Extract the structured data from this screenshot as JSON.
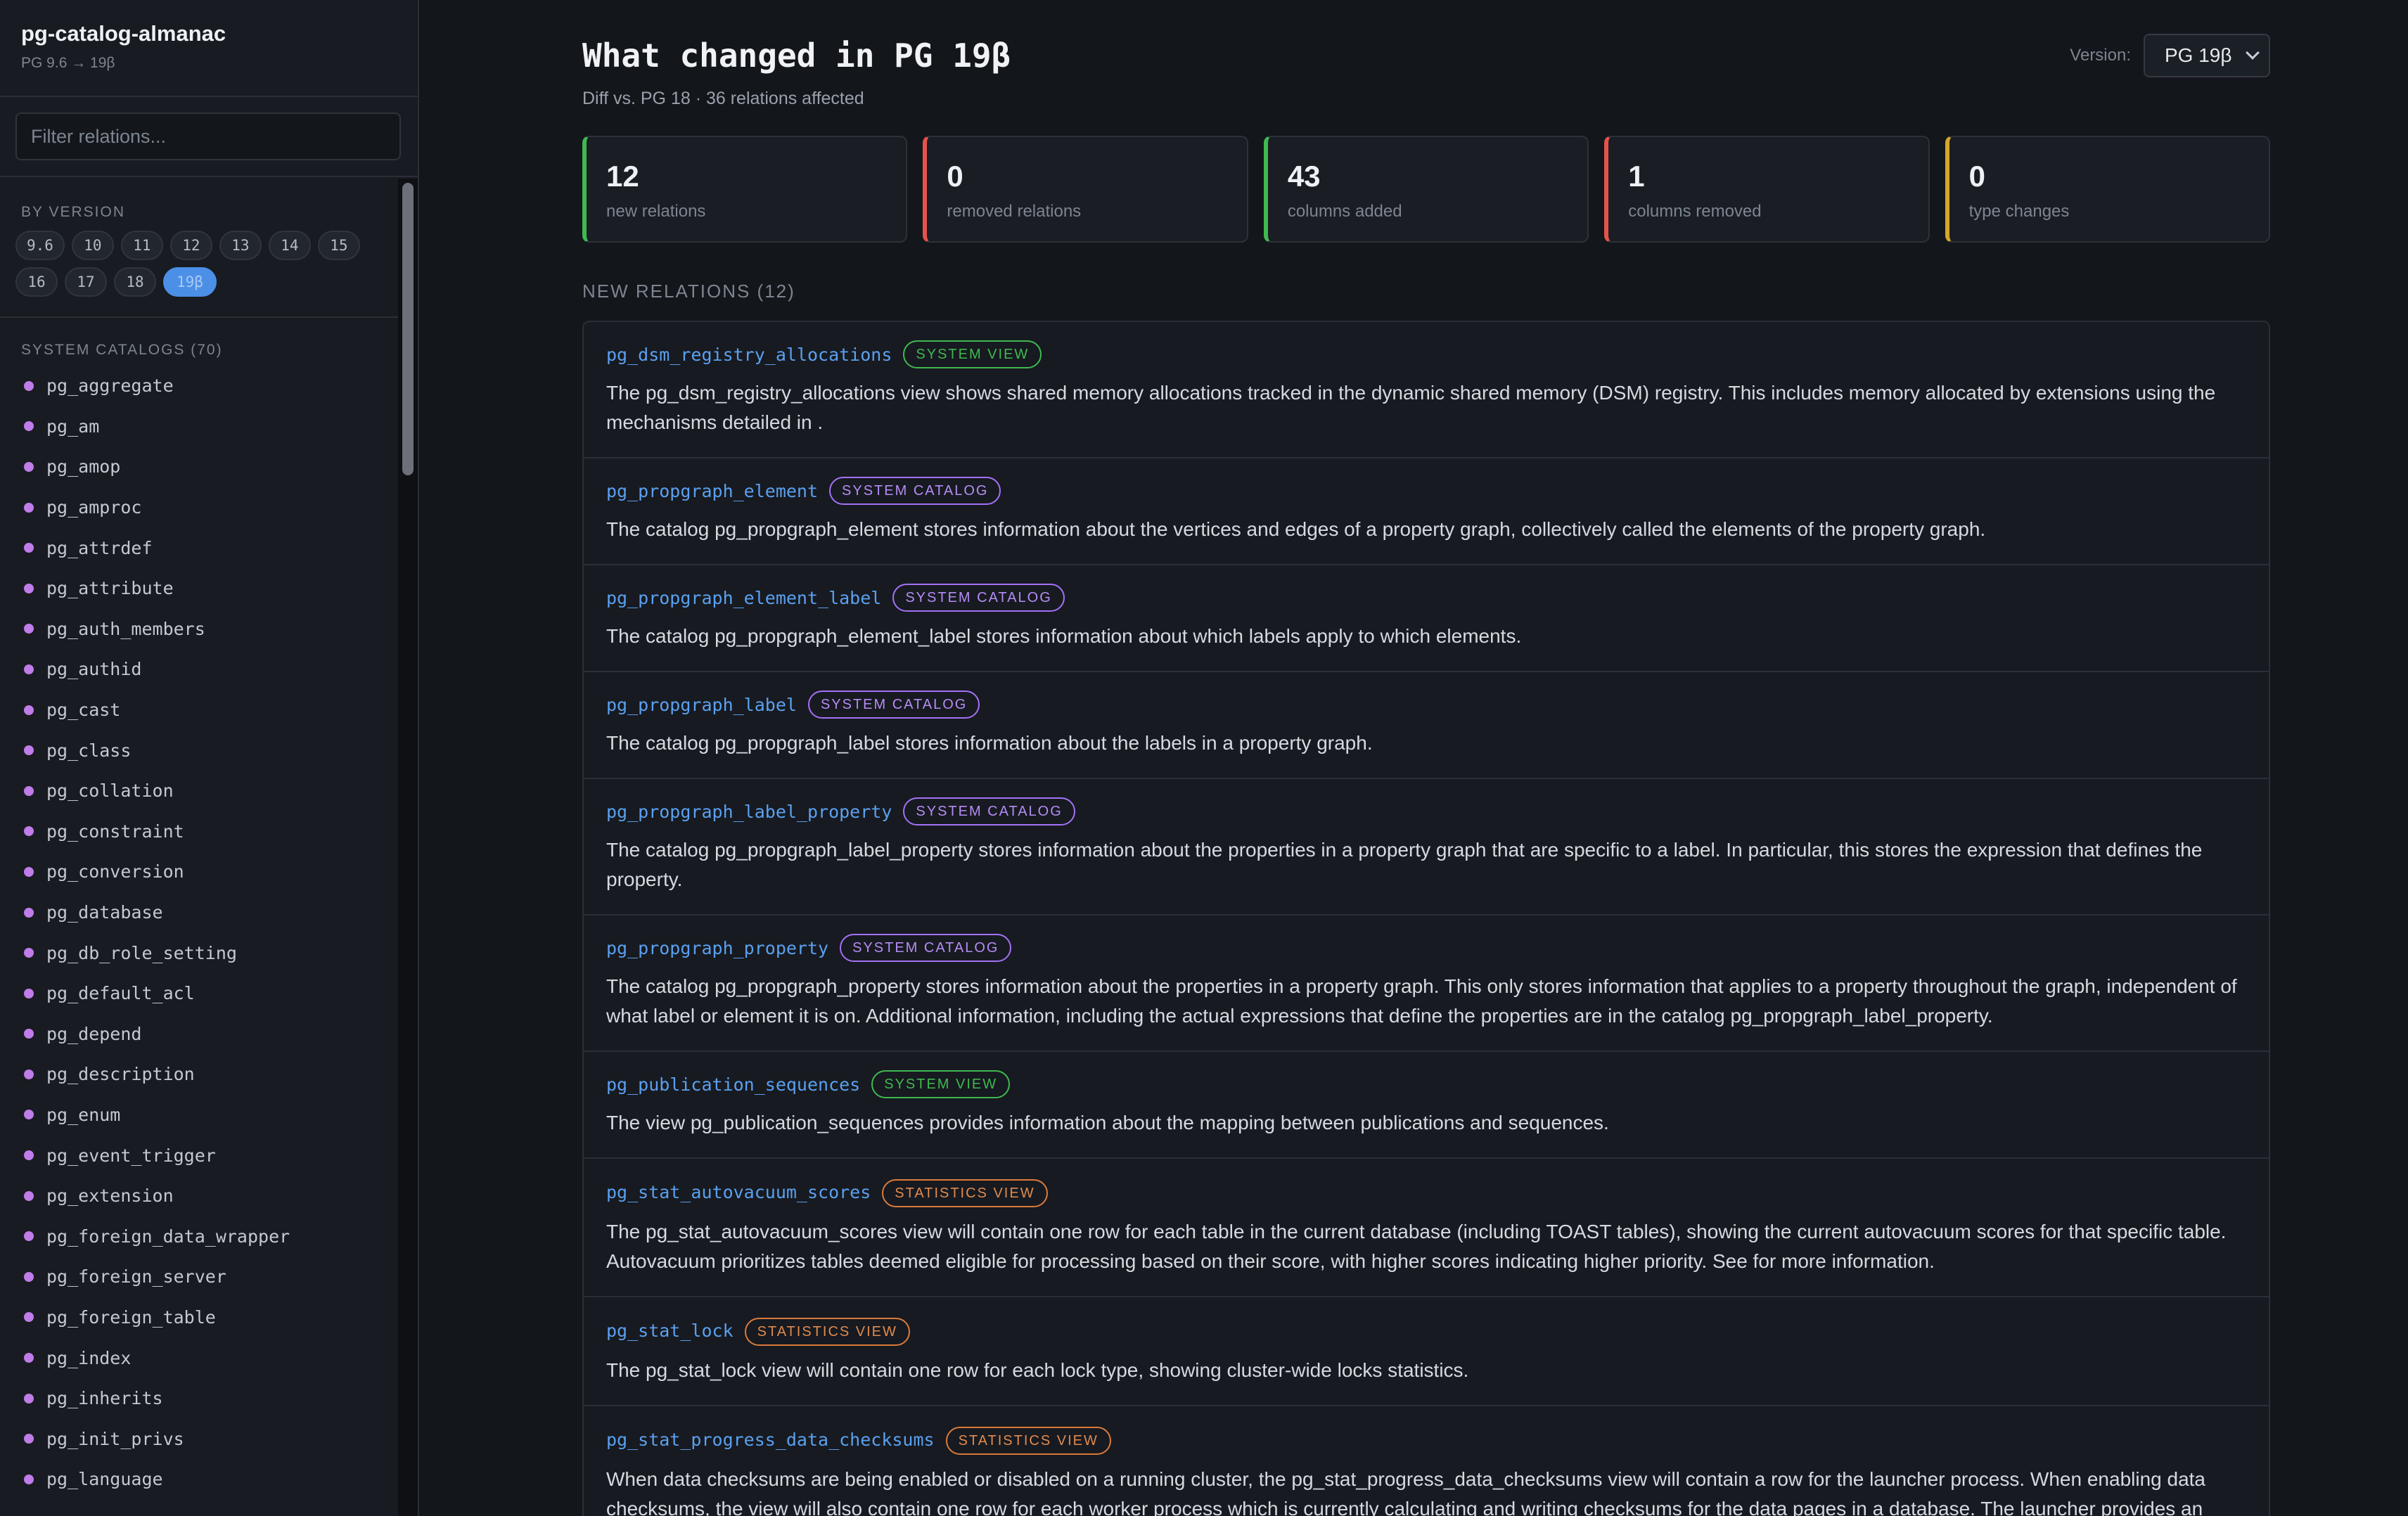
{
  "sidebar": {
    "title": "pg-catalog-almanac",
    "subtitle": "PG 9.6 → 19β",
    "filter_placeholder": "Filter relations...",
    "by_version_label": "BY VERSION",
    "versions": [
      "9.6",
      "10",
      "11",
      "12",
      "13",
      "14",
      "15",
      "16",
      "17",
      "18",
      "19β"
    ],
    "active_version": "19β",
    "catalogs_label": "SYSTEM CATALOGS (70)",
    "catalogs": [
      "pg_aggregate",
      "pg_am",
      "pg_amop",
      "pg_amproc",
      "pg_attrdef",
      "pg_attribute",
      "pg_auth_members",
      "pg_authid",
      "pg_cast",
      "pg_class",
      "pg_collation",
      "pg_constraint",
      "pg_conversion",
      "pg_database",
      "pg_db_role_setting",
      "pg_default_acl",
      "pg_depend",
      "pg_description",
      "pg_enum",
      "pg_event_trigger",
      "pg_extension",
      "pg_foreign_data_wrapper",
      "pg_foreign_server",
      "pg_foreign_table",
      "pg_index",
      "pg_inherits",
      "pg_init_privs",
      "pg_language"
    ]
  },
  "header": {
    "title": "What changed in PG 19β",
    "subtitle": "Diff vs. PG 18  ·  36 relations affected",
    "version_label": "Version:",
    "version_value": "PG 19β"
  },
  "stats": [
    {
      "value": "12",
      "label": "new relations",
      "color": "#3fb950"
    },
    {
      "value": "0",
      "label": "removed relations",
      "color": "#e5534b"
    },
    {
      "value": "43",
      "label": "columns added",
      "color": "#3fb950"
    },
    {
      "value": "1",
      "label": "columns removed",
      "color": "#e5534b"
    },
    {
      "value": "0",
      "label": "type changes",
      "color": "#d4a72c"
    }
  ],
  "new_relations": {
    "heading": "NEW RELATIONS (12)",
    "items": [
      {
        "name": "pg_dsm_registry_allocations",
        "badge": "SYSTEM VIEW",
        "kind": "view",
        "desc": "The pg_dsm_registry_allocations view shows shared memory allocations tracked in the dynamic shared memory (DSM) registry. This includes memory allocated by extensions using the mechanisms detailed in ."
      },
      {
        "name": "pg_propgraph_element",
        "badge": "SYSTEM CATALOG",
        "kind": "catalog",
        "desc": "The catalog pg_propgraph_element stores information about the vertices and edges of a property graph, collectively called the elements of the property graph."
      },
      {
        "name": "pg_propgraph_element_label",
        "badge": "SYSTEM CATALOG",
        "kind": "catalog",
        "desc": "The catalog pg_propgraph_element_label stores information about which labels apply to which elements."
      },
      {
        "name": "pg_propgraph_label",
        "badge": "SYSTEM CATALOG",
        "kind": "catalog",
        "desc": "The catalog pg_propgraph_label stores information about the labels in a property graph."
      },
      {
        "name": "pg_propgraph_label_property",
        "badge": "SYSTEM CATALOG",
        "kind": "catalog",
        "desc": "The catalog pg_propgraph_label_property stores information about the properties in a property graph that are specific to a label. In particular, this stores the expression that defines the property."
      },
      {
        "name": "pg_propgraph_property",
        "badge": "SYSTEM CATALOG",
        "kind": "catalog",
        "desc": "The catalog pg_propgraph_property stores information about the properties in a property graph. This only stores information that applies to a property throughout the graph, independent of what label or element it is on. Additional information, including the actual expressions that define the properties are in the catalog pg_propgraph_label_property."
      },
      {
        "name": "pg_publication_sequences",
        "badge": "SYSTEM VIEW",
        "kind": "view",
        "desc": "The view pg_publication_sequences provides information about the mapping between publications and sequences."
      },
      {
        "name": "pg_stat_autovacuum_scores",
        "badge": "STATISTICS VIEW",
        "kind": "stats",
        "desc": "The pg_stat_autovacuum_scores view will contain one row for each table in the current database (including TOAST tables), showing the current autovacuum scores for that specific table. Autovacuum prioritizes tables deemed eligible for processing based on their score, with higher scores indicating higher priority. See for more information."
      },
      {
        "name": "pg_stat_lock",
        "badge": "STATISTICS VIEW",
        "kind": "stats",
        "desc": "The pg_stat_lock view will contain one row for each lock type, showing cluster-wide locks statistics."
      },
      {
        "name": "pg_stat_progress_data_checksums",
        "badge": "STATISTICS VIEW",
        "kind": "stats",
        "desc": "When data checksums are being enabled or disabled on a running cluster, the pg_stat_progress_data_checksums view will contain a row for the launcher process. When enabling data checksums, the view will also contain one row for each worker process which is currently calculating and writing checksums for the data pages in a database. The launcher provides an overview of the overall progress, such as how many databases have been processed and how many remain, while the workers track progress for currently processed databases."
      }
    ]
  }
}
